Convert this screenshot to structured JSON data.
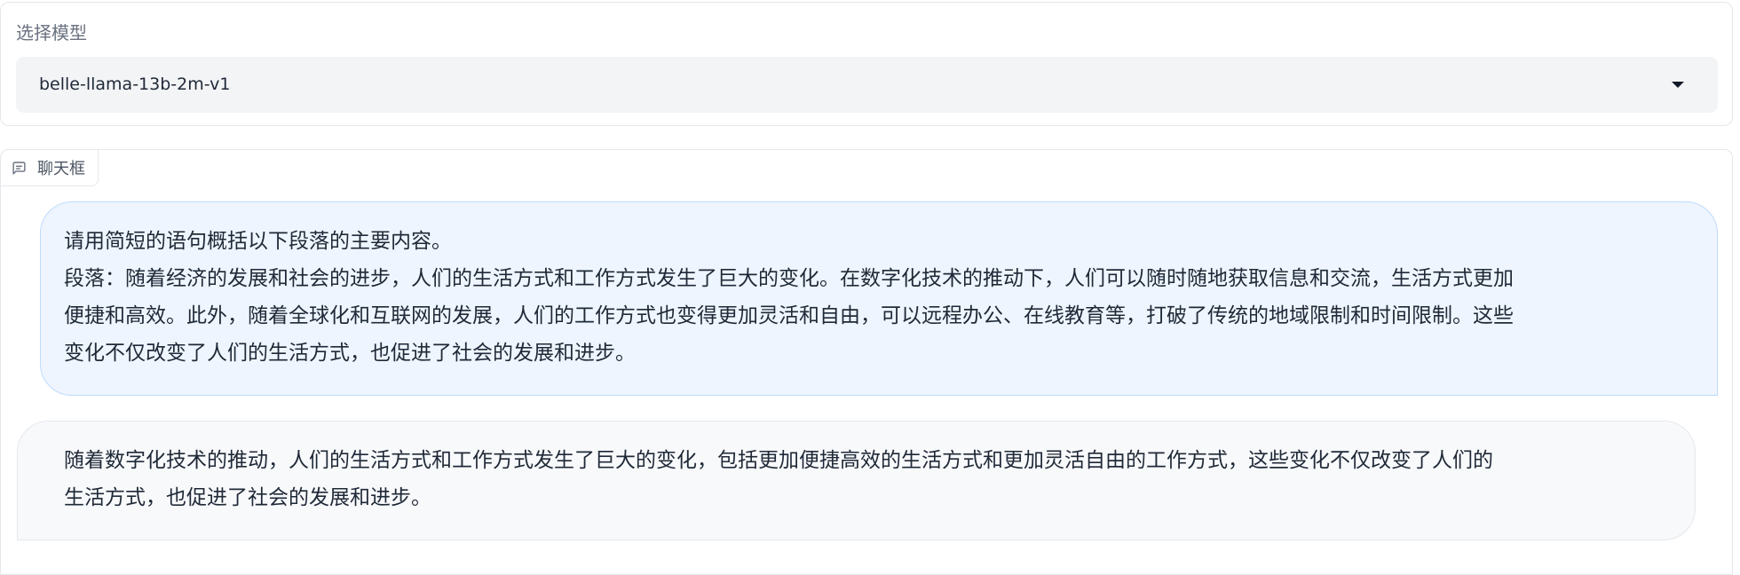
{
  "model_selector": {
    "label": "选择模型",
    "selected": "belle-llama-13b-2m-v1"
  },
  "chatbox": {
    "tab_label": "聊天框",
    "tab_icon": "chat-bubble-icon",
    "messages": [
      {
        "role": "user",
        "lines": [
          "请用简短的语句概括以下段落的主要内容。",
          "段落：随着经济的发展和社会的进步，人们的生活方式和工作方式发生了巨大的变化。在数字化技术的推动下，人们可以随时随地获取信息和交流，生活方式更加",
          "便捷和高效。此外，随着全球化和互联网的发展，人们的工作方式也变得更加灵活和自由，可以远程办公、在线教育等，打破了传统的地域限制和时间限制。这些",
          "变化不仅改变了人们的生活方式，也促进了社会的发展和进步。"
        ]
      },
      {
        "role": "bot",
        "lines": [
          "随着数字化技术的推动，人们的生活方式和工作方式发生了巨大的变化，包括更加便捷高效的生活方式和更加灵活自由的工作方式，这些变化不仅改变了人们的",
          "生活方式，也促进了社会的发展和进步。"
        ]
      }
    ]
  },
  "colors": {
    "user_bubble_bg": "#eef5fe",
    "user_bubble_border": "#bfdbfe",
    "bot_bubble_bg": "#f8f9fb",
    "select_bg": "#f3f4f6"
  }
}
